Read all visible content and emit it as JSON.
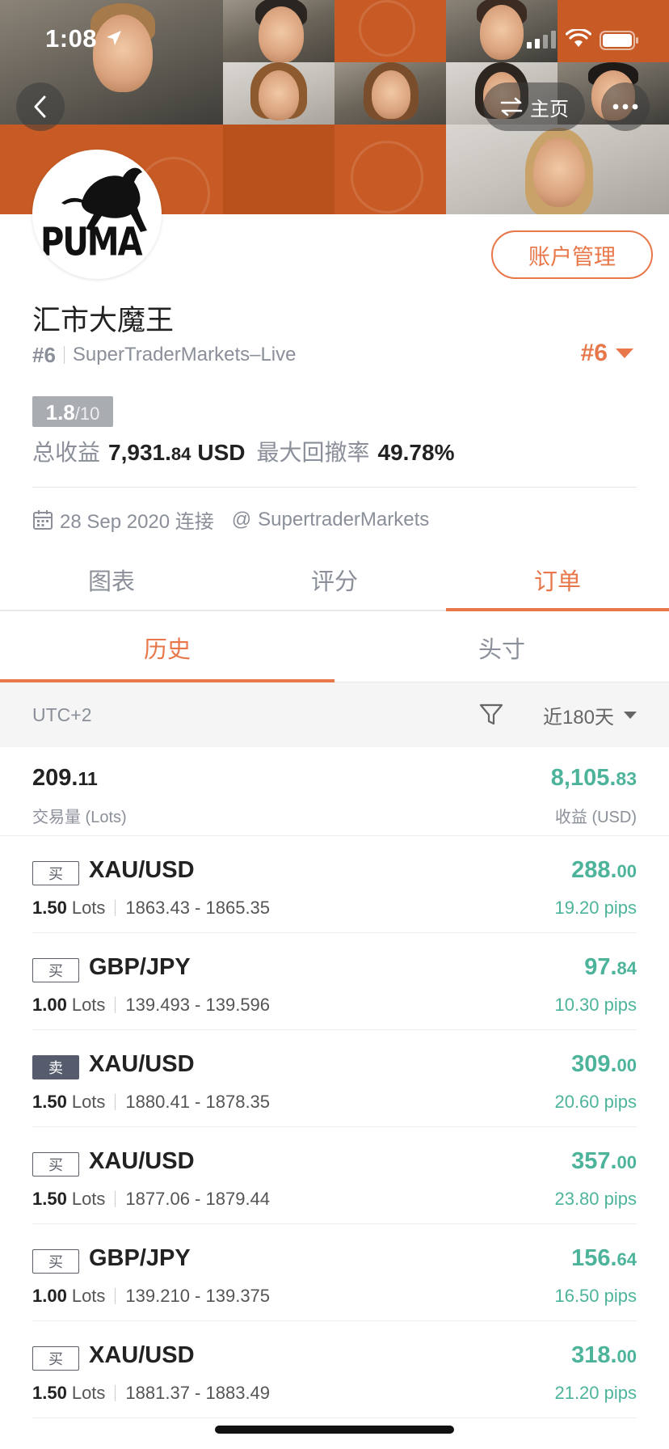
{
  "status_bar": {
    "time": "1:08"
  },
  "header": {
    "home_label": "主页"
  },
  "profile": {
    "account_button": "账户管理",
    "name": "汇市大魔王",
    "rank": "#6",
    "broker": "SuperTraderMarkets–Live",
    "rank_right": "#6",
    "score_main": "1.8",
    "score_total": "/10",
    "total_profit_label": "总收益",
    "total_profit_int": "7,931.",
    "total_profit_dec": "84",
    "total_profit_unit": "USD",
    "drawdown_label": "最大回撤率",
    "drawdown_value": "49.78%",
    "connected_date": "28 Sep 2020 连接",
    "handle": "SupertraderMarkets"
  },
  "tabs": [
    {
      "label": "图表",
      "active": false
    },
    {
      "label": "评分",
      "active": false
    },
    {
      "label": "订单",
      "active": true
    }
  ],
  "subtabs": [
    {
      "label": "历史",
      "active": true
    },
    {
      "label": "头寸",
      "active": false
    }
  ],
  "filter": {
    "timezone": "UTC+2",
    "range": "近180天"
  },
  "summary": {
    "lots_int": "209.",
    "lots_dec": "11",
    "lots_label": "交易量 (Lots)",
    "profit_int": "8,105.",
    "profit_dec": "83",
    "profit_label": "收益 (USD)"
  },
  "orders": [
    {
      "side": "买",
      "type": "buy",
      "pair": "XAU/USD",
      "lots": "1.50",
      "lots_unit": "Lots",
      "range": "1863.43 - 1865.35",
      "profit_int": "288.",
      "profit_dec": "00",
      "pips": "19.20 pips"
    },
    {
      "side": "买",
      "type": "buy",
      "pair": "GBP/JPY",
      "lots": "1.00",
      "lots_unit": "Lots",
      "range": "139.493 - 139.596",
      "profit_int": "97.",
      "profit_dec": "84",
      "pips": "10.30 pips"
    },
    {
      "side": "卖",
      "type": "sell",
      "pair": "XAU/USD",
      "lots": "1.50",
      "lots_unit": "Lots",
      "range": "1880.41 - 1878.35",
      "profit_int": "309.",
      "profit_dec": "00",
      "pips": "20.60 pips"
    },
    {
      "side": "买",
      "type": "buy",
      "pair": "XAU/USD",
      "lots": "1.50",
      "lots_unit": "Lots",
      "range": "1877.06 - 1879.44",
      "profit_int": "357.",
      "profit_dec": "00",
      "pips": "23.80 pips"
    },
    {
      "side": "买",
      "type": "buy",
      "pair": "GBP/JPY",
      "lots": "1.00",
      "lots_unit": "Lots",
      "range": "139.210 - 139.375",
      "profit_int": "156.",
      "profit_dec": "64",
      "pips": "16.50 pips"
    },
    {
      "side": "买",
      "type": "buy",
      "pair": "XAU/USD",
      "lots": "1.50",
      "lots_unit": "Lots",
      "range": "1881.37 - 1883.49",
      "profit_int": "318.",
      "profit_dec": "00",
      "pips": "21.20 pips"
    }
  ],
  "colors": {
    "accent": "#e8774a",
    "profit": "#4db49b",
    "sell_badge": "#565c6e"
  },
  "icons": [
    "location-arrow-icon",
    "signal-icon",
    "wifi-icon",
    "battery-icon",
    "back-chevron-icon",
    "swap-arrows-icon",
    "more-dots-icon",
    "calendar-icon",
    "at-icon",
    "funnel-icon",
    "dropdown-triangle-icon"
  ]
}
